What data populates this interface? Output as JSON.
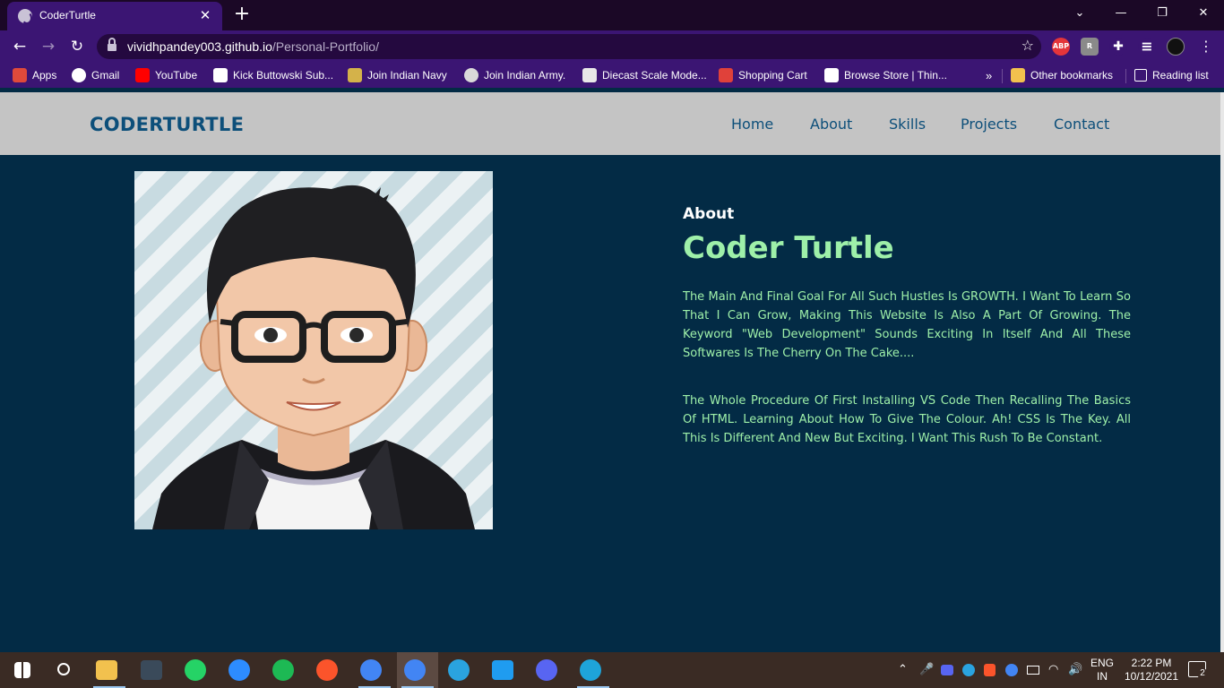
{
  "browser": {
    "tab": {
      "title": "CoderTurtle",
      "close": "✕"
    },
    "new_tab": "+",
    "window": {
      "minimize": "—",
      "restore": "❐",
      "close": "✕",
      "tab_search": "⌄"
    },
    "nav": {
      "back": "←",
      "forward": "→",
      "reload": "↻"
    },
    "url": {
      "host": "vividhpandey003.github.io",
      "path": "/Personal-Portfolio/"
    },
    "bookmarks": [
      {
        "label": "Apps",
        "icon": "apps-grid-icon",
        "color": "#e04a3a"
      },
      {
        "label": "Gmail",
        "icon": "google-icon",
        "color": "#ffffff"
      },
      {
        "label": "YouTube",
        "icon": "youtube-icon",
        "color": "#ff0000"
      },
      {
        "label": "Kick Buttowski Sub...",
        "icon": "d-logo-icon",
        "color": "#ffffff"
      },
      {
        "label": "Join Indian Navy",
        "icon": "navy-emblem-icon",
        "color": "#d4b24a"
      },
      {
        "label": "Join Indian Army.",
        "icon": "globe-icon",
        "color": "#d9d9d9"
      },
      {
        "label": "Diecast Scale Mode...",
        "icon": "store-icon",
        "color": "#e8e8e8"
      },
      {
        "label": "Shopping Cart",
        "icon": "cart-icon",
        "color": "#e0413a"
      },
      {
        "label": "Browse Store | Thin...",
        "icon": "store-logo-icon",
        "color": "#ffffff"
      }
    ],
    "bookmarks_overflow": "»",
    "other_bookmarks": "Other bookmarks",
    "reading_list": "Reading list",
    "extensions": [
      {
        "name": "adblock-icon",
        "text": "ABP",
        "color": "#e4353a"
      },
      {
        "name": "extension-r-icon",
        "text": "R",
        "color": "#8a8a8a"
      },
      {
        "name": "puzzle-icon",
        "text": "✚",
        "color": "#3b1573"
      },
      {
        "name": "media-icon",
        "text": "≡",
        "color": "#3b1573"
      },
      {
        "name": "profile-avatar-icon",
        "text": "",
        "color": "#111111"
      }
    ]
  },
  "site": {
    "brand": "CODERTURTLE",
    "nav": [
      "Home",
      "About",
      "Skills",
      "Projects",
      "Contact"
    ],
    "about": {
      "subtitle": "About",
      "title": "Coder Turtle",
      "p1": "The Main And Final Goal For All Such Hustles Is GROWTH. I Want To Learn So That I Can Grow, Making This Website Is Also A Part Of Growing. The Keyword \"Web Development\" Sounds Exciting In Itself And All These Softwares Is The Cherry On The Cake....",
      "p2": "The Whole Procedure Of First Installing VS Code Then Recalling The Basics Of HTML. Learning About How To Give The Colour. Ah! CSS Is The Key. All This Is Different And New But Exciting. I Want This Rush To Be Constant."
    },
    "colors": {
      "background": "#032b45",
      "navbar": "#c4c4c4",
      "brand": "#0d4f7a",
      "accent": "#9ef0a9"
    }
  },
  "taskbar": {
    "apps": [
      {
        "name": "windows-start-icon",
        "color": "#ffffff"
      },
      {
        "name": "search-icon",
        "color": "#ffffff"
      },
      {
        "name": "file-explorer-icon",
        "color": "#f2c14e"
      },
      {
        "name": "terminal-app-icon",
        "color": "#3a4a5a"
      },
      {
        "name": "whatsapp-icon",
        "color": "#25d366"
      },
      {
        "name": "zoom-icon",
        "color": "#2d8cff"
      },
      {
        "name": "spotify-icon",
        "color": "#1db954"
      },
      {
        "name": "brave-icon",
        "color": "#fb542b"
      },
      {
        "name": "chrome-icon",
        "color": "#4285f4"
      },
      {
        "name": "chrome-profile-icon",
        "color": "#4285f4"
      },
      {
        "name": "telegram-icon",
        "color": "#2aa3df"
      },
      {
        "name": "vscode-icon",
        "color": "#1f9cf0"
      },
      {
        "name": "discord-icon",
        "color": "#5865f2"
      },
      {
        "name": "edge-icon",
        "color": "#1ea4d9"
      }
    ],
    "language": "ENG",
    "region": "IN",
    "time": "2:22 PM",
    "date": "10/12/2021",
    "notifications": "2"
  }
}
